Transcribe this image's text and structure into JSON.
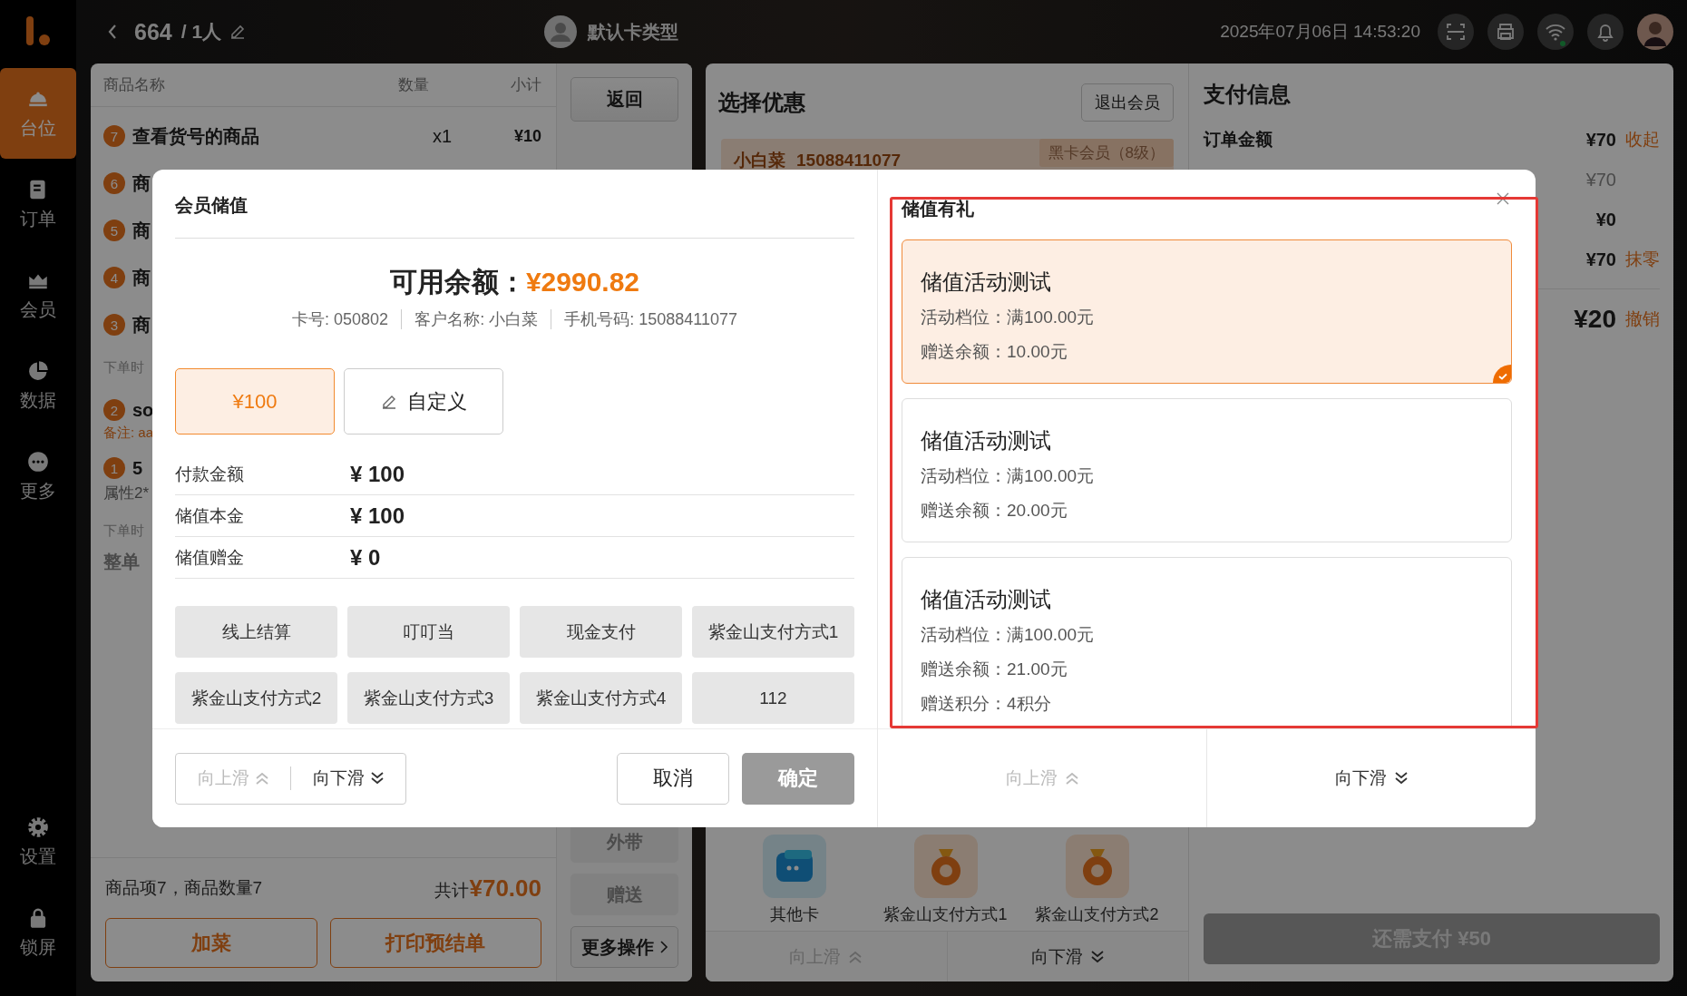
{
  "sidebar": {
    "items": [
      {
        "label": "台位",
        "selected": true
      },
      {
        "label": "订单",
        "selected": false
      },
      {
        "label": "会员",
        "selected": false
      },
      {
        "label": "数据",
        "selected": false
      },
      {
        "label": "更多",
        "selected": false
      }
    ],
    "bottom_items": [
      {
        "label": "设置"
      },
      {
        "label": "锁屏"
      }
    ]
  },
  "top_bar": {
    "table_no": "664",
    "guests": "/ 1人",
    "card_type": "默认卡类型",
    "datetime": "2025年07月06日 14:53:20",
    "wifi_connected": true
  },
  "order": {
    "columns": [
      "商品名称",
      "数量",
      "小计"
    ],
    "lines": [
      {
        "kind": "item",
        "no": "7",
        "name": "查看货号的商品",
        "qty": "x1",
        "subtotal": "¥10"
      },
      {
        "kind": "item",
        "no": "6",
        "name": "商"
      },
      {
        "kind": "item",
        "no": "5",
        "name": "商"
      },
      {
        "kind": "item",
        "no": "4",
        "name": "商"
      },
      {
        "kind": "item",
        "no": "3",
        "name": "商"
      },
      {
        "kind": "time",
        "text": "下单时"
      },
      {
        "kind": "item",
        "no": "2",
        "name": "so"
      },
      {
        "kind": "note",
        "text": "备注: aa"
      },
      {
        "kind": "item",
        "no": "1",
        "name": "5"
      },
      {
        "kind": "attr",
        "text": "属性2*"
      },
      {
        "kind": "time",
        "text": "下单时"
      },
      {
        "kind": "remark",
        "text": "整单"
      }
    ],
    "summary": "商品项7，商品数量7",
    "total_label": "共计",
    "total": "¥70.00",
    "buttons": [
      "加菜",
      "打印预结单"
    ]
  },
  "actions": {
    "back": "返回",
    "items": [
      {
        "label": "外带",
        "kind": "plain",
        "disabled": true
      },
      {
        "label": "赠送",
        "kind": "plain",
        "disabled": true
      },
      {
        "label": "更多操作",
        "kind": "menu",
        "disabled": false
      }
    ]
  },
  "discount": {
    "title": "选择优惠",
    "exit_button": "退出会员",
    "member": {
      "name": "小白菜",
      "phone": "15088411077",
      "level": "黑卡会员（8级）"
    },
    "methods": [
      {
        "kind": "card",
        "label": "其他卡"
      },
      {
        "kind": "bag",
        "label": "紫金山支付方式1"
      },
      {
        "kind": "bag",
        "label": "紫金山支付方式2"
      }
    ],
    "scroll": [
      {
        "label": "向上滑",
        "kind": "up",
        "disabled": true
      },
      {
        "label": "向下滑",
        "kind": "down",
        "disabled": false
      }
    ]
  },
  "payment": {
    "title": "支付信息",
    "rows": [
      {
        "kind": "head",
        "label": "订单金额",
        "value": "¥70",
        "action": "收起"
      },
      {
        "kind": "sub",
        "value": "¥70"
      },
      {
        "kind": "line",
        "value": "¥0"
      },
      {
        "kind": "line",
        "value": "¥70",
        "action": "抹零"
      },
      {
        "kind": "big",
        "value": "¥20",
        "action": "撤销"
      }
    ],
    "pay_button": {
      "label": "还需支付 ¥50",
      "disabled": true
    }
  },
  "dialog": {
    "left": {
      "title": "会员储值",
      "balance_label": "可用余额：",
      "balance": "¥2990.82",
      "info": [
        "卡号: 050802",
        "客户名称: 小白菜",
        "手机号码: 15088411077"
      ],
      "amounts": [
        {
          "kind": "preset",
          "label": "¥100",
          "selected": true
        },
        {
          "kind": "custom",
          "label": "自定义",
          "selected": false
        }
      ],
      "details": [
        {
          "label": "付款金额",
          "value": "¥ 100"
        },
        {
          "label": "储值本金",
          "value": "¥ 100"
        },
        {
          "label": "储值赠金",
          "value": "¥ 0"
        }
      ],
      "pay_methods": [
        "线上结算",
        "叮叮当",
        "现金支付",
        "紫金山支付方式1",
        "紫金山支付方式2",
        "紫金山支付方式3",
        "紫金山支付方式4",
        "112"
      ],
      "scroll": [
        {
          "label": "向上滑",
          "kind": "up",
          "disabled": true
        },
        {
          "label": "向下滑",
          "kind": "down",
          "disabled": false
        }
      ],
      "cancel": {
        "label": "取消",
        "disabled": false
      },
      "confirm": {
        "label": "确定",
        "disabled": true
      }
    },
    "right": {
      "title": "储值有礼",
      "gifts": [
        {
          "title": "储值活动测试",
          "lines": [
            "活动档位：满100.00元",
            "赠送余额：10.00元"
          ],
          "selected": true
        },
        {
          "title": "储值活动测试",
          "lines": [
            "活动档位：满100.00元",
            "赠送余额：20.00元"
          ],
          "selected": false
        },
        {
          "title": "储值活动测试",
          "lines": [
            "活动档位：满100.00元",
            "赠送余额：21.00元",
            "赠送积分：4积分"
          ],
          "selected": false
        }
      ],
      "scroll": [
        {
          "label": "向上滑",
          "kind": "up",
          "disabled": true
        },
        {
          "label": "向下滑",
          "kind": "down",
          "disabled": false
        }
      ]
    }
  },
  "highlight": true
}
